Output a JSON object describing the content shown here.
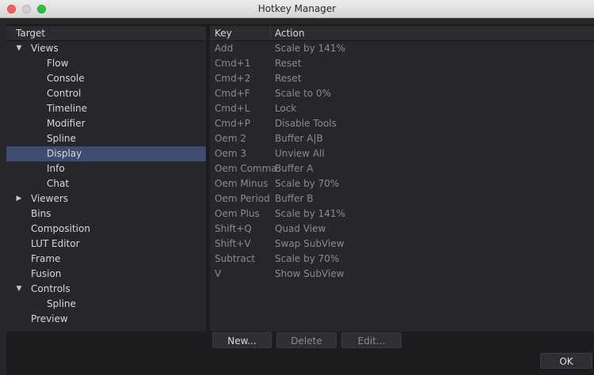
{
  "window": {
    "title": "Hotkey Manager"
  },
  "tree": {
    "header": "Target",
    "items": [
      {
        "label": "Views",
        "level": 0,
        "expand": "expanded"
      },
      {
        "label": "Flow",
        "level": 1,
        "expand": "none"
      },
      {
        "label": "Console",
        "level": 1,
        "expand": "none"
      },
      {
        "label": "Control",
        "level": 1,
        "expand": "none"
      },
      {
        "label": "Timeline",
        "level": 1,
        "expand": "none"
      },
      {
        "label": "Modifier",
        "level": 1,
        "expand": "none"
      },
      {
        "label": "Spline",
        "level": 1,
        "expand": "none"
      },
      {
        "label": "Display",
        "level": 1,
        "expand": "none",
        "selected": true
      },
      {
        "label": "Info",
        "level": 1,
        "expand": "none"
      },
      {
        "label": "Chat",
        "level": 1,
        "expand": "none"
      },
      {
        "label": "Viewers",
        "level": 0,
        "expand": "collapsed"
      },
      {
        "label": "Bins",
        "level": 0,
        "expand": "none"
      },
      {
        "label": "Composition",
        "level": 0,
        "expand": "none"
      },
      {
        "label": "LUT Editor",
        "level": 0,
        "expand": "none"
      },
      {
        "label": "Frame",
        "level": 0,
        "expand": "none"
      },
      {
        "label": "Fusion",
        "level": 0,
        "expand": "none"
      },
      {
        "label": "Controls",
        "level": 0,
        "expand": "expanded"
      },
      {
        "label": "Spline",
        "level": 1,
        "expand": "none"
      },
      {
        "label": "Preview",
        "level": 0,
        "expand": "none"
      }
    ]
  },
  "hotkeys": {
    "columns": {
      "key": "Key",
      "action": "Action"
    },
    "rows": [
      {
        "key": "Add",
        "action": "Scale by 141%"
      },
      {
        "key": "Cmd+1",
        "action": "Reset"
      },
      {
        "key": "Cmd+2",
        "action": "Reset"
      },
      {
        "key": "Cmd+F",
        "action": "Scale to 0%"
      },
      {
        "key": "Cmd+L",
        "action": "Lock"
      },
      {
        "key": "Cmd+P",
        "action": "Disable Tools"
      },
      {
        "key": "Oem 2",
        "action": "Buffer A|B"
      },
      {
        "key": "Oem 3",
        "action": "Unview All"
      },
      {
        "key": "Oem Comma",
        "action": "Buffer A"
      },
      {
        "key": "Oem Minus",
        "action": "Scale by 70%"
      },
      {
        "key": "Oem Period",
        "action": "Buffer B"
      },
      {
        "key": "Oem Plus",
        "action": "Scale by 141%"
      },
      {
        "key": "Shift+Q",
        "action": "Quad View"
      },
      {
        "key": "Shift+V",
        "action": "Swap SubView"
      },
      {
        "key": "Subtract",
        "action": "Scale by 70%"
      },
      {
        "key": "V",
        "action": "Show SubView"
      }
    ]
  },
  "buttons": {
    "new": "New...",
    "delete": "Delete",
    "edit": "Edit...",
    "ok": "OK"
  }
}
